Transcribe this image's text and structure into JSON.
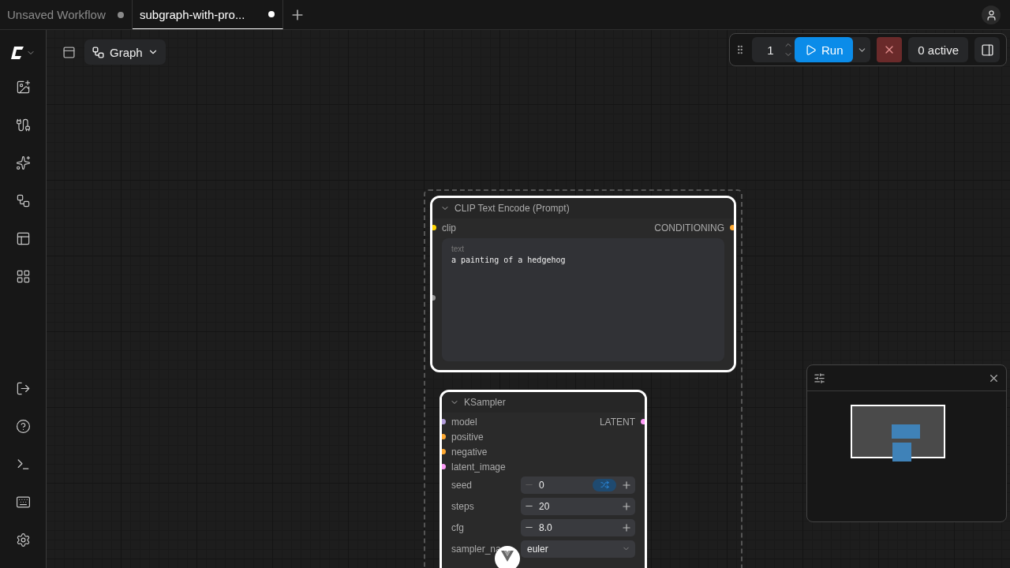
{
  "tabs": [
    {
      "label": "Unsaved Workflow",
      "selected": false,
      "modified": true
    },
    {
      "label": "subgraph-with-pro...",
      "selected": true,
      "modified": true
    }
  ],
  "canvas_toolbar": {
    "view_button": "Graph"
  },
  "queue": {
    "batch_count": "1",
    "run_label": "Run",
    "active_label": "0 active"
  },
  "nodes": [
    {
      "title": "CLIP Text Encode (Prompt)",
      "selected": true,
      "inputs": [
        {
          "label": "clip",
          "color": "#ffd500"
        }
      ],
      "outputs": [
        {
          "label": "CONDITIONING",
          "color": "#ffa931"
        }
      ],
      "text_field": {
        "label": "text",
        "value": "a painting of a hedgehog"
      }
    },
    {
      "title": "KSampler",
      "selected": true,
      "inputs": [
        {
          "label": "model",
          "color": "#b39ddb"
        },
        {
          "label": "positive",
          "color": "#ffa931"
        },
        {
          "label": "negative",
          "color": "#ffa931"
        },
        {
          "label": "latent_image",
          "color": "#ff9cf9"
        }
      ],
      "outputs": [
        {
          "label": "LATENT",
          "color": "#ff9cf9"
        }
      ],
      "widgets": [
        {
          "kind": "number",
          "label": "seed",
          "value": "0",
          "randomize": true,
          "decrement_disabled": true
        },
        {
          "kind": "number",
          "label": "steps",
          "value": "20",
          "randomize": false,
          "decrement_disabled": false
        },
        {
          "kind": "number",
          "label": "cfg",
          "value": "8.0",
          "randomize": false,
          "decrement_disabled": false
        },
        {
          "kind": "combo",
          "label": "sampler_na",
          "value": "euler"
        }
      ]
    }
  ]
}
